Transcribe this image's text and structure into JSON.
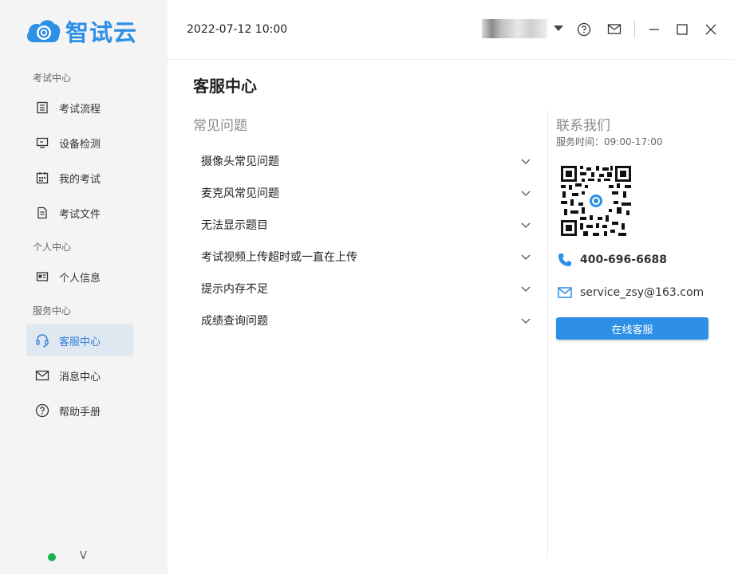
{
  "app": {
    "logo_text": "智试云"
  },
  "topbar": {
    "datetime": "2022-07-12 10:00"
  },
  "sidebar": {
    "groups": [
      {
        "title": "考试中心",
        "items": [
          {
            "label": "考试流程",
            "icon": "list-icon"
          },
          {
            "label": "设备检测",
            "icon": "monitor-icon"
          },
          {
            "label": "我的考试",
            "icon": "calendar-icon"
          },
          {
            "label": "考试文件",
            "icon": "document-icon"
          }
        ]
      },
      {
        "title": "个人中心",
        "items": [
          {
            "label": "个人信息",
            "icon": "id-card-icon"
          }
        ]
      },
      {
        "title": "服务中心",
        "items": [
          {
            "label": "客服中心",
            "icon": "headset-icon",
            "active": true
          },
          {
            "label": "消息中心",
            "icon": "mail-icon"
          },
          {
            "label": "帮助手册",
            "icon": "help-icon"
          }
        ]
      }
    ],
    "version": "V",
    "status_color": "#18b24b"
  },
  "main": {
    "title": "客服中心",
    "faq_title": "常见问题",
    "faq_items": [
      "摄像头常见问题",
      "麦克风常见问题",
      "无法显示题目",
      "考试视频上传超时或一直在上传",
      "提示内存不足",
      "成绩查询问题"
    ],
    "contact": {
      "title": "联系我们",
      "service_time": "服务时间：09:00-17:00",
      "phone": "400-696-6688",
      "email": "service_zsy@163.com",
      "button": "在线客服"
    }
  },
  "colors": {
    "accent": "#2d8fe6",
    "active_bg": "#dfe7f1",
    "sidebar_bg": "#f4f4f4"
  }
}
